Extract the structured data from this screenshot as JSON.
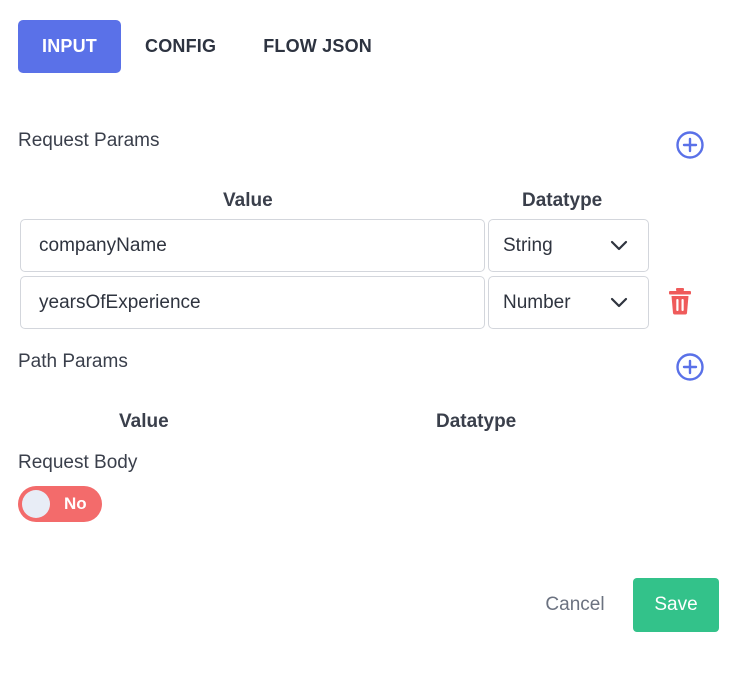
{
  "tabs": [
    {
      "label": "INPUT",
      "active": true
    },
    {
      "label": "CONFIG",
      "active": false
    },
    {
      "label": "FLOW JSON",
      "active": false
    }
  ],
  "request_params": {
    "title": "Request Params",
    "add_icon": "plus-circle-icon",
    "columns": {
      "value": "Value",
      "datatype": "Datatype"
    },
    "rows": [
      {
        "value": "companyName",
        "datatype": "String"
      },
      {
        "value": "yearsOfExperience",
        "datatype": "Number"
      }
    ],
    "delete_icon": "trash-icon"
  },
  "path_params": {
    "title": "Path Params",
    "add_icon": "plus-circle-icon",
    "columns": {
      "value": "Value",
      "datatype": "Datatype"
    }
  },
  "request_body": {
    "title": "Request Body",
    "toggle_label": "No",
    "toggle_on": false
  },
  "actions": {
    "cancel_label": "Cancel",
    "save_label": "Save"
  },
  "colors": {
    "primary": "#5a71e8",
    "toggle_off": "#f36b6b",
    "delete": "#ef5b5b",
    "save": "#33c28a"
  }
}
